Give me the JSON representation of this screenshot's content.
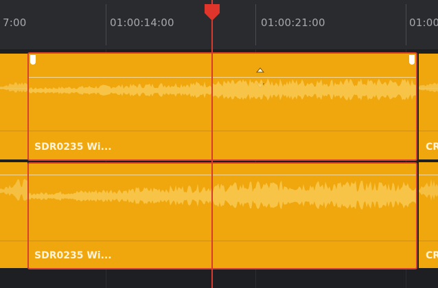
{
  "ruler": {
    "timecodes": [
      "7:00",
      "01:00:14:00",
      "01:00:21:00",
      "01:00"
    ]
  },
  "tracks": [
    {
      "clips": [
        {
          "name": ""
        },
        {
          "name": "SDR0235 Wi..."
        },
        {
          "name": "CR"
        }
      ]
    },
    {
      "clips": [
        {
          "name": ""
        },
        {
          "name": "SDR0235 Wi..."
        },
        {
          "name": "CR"
        }
      ]
    }
  ],
  "colors": {
    "clip_fill": "#f0a70e",
    "selection_border": "#d6402f",
    "playhead": "#e0352b",
    "background": "#1e1f22"
  },
  "icons": {
    "playhead": "playhead-marker-icon",
    "fade_up": "triangle-up-icon",
    "fade_down": "triangle-down-icon"
  }
}
